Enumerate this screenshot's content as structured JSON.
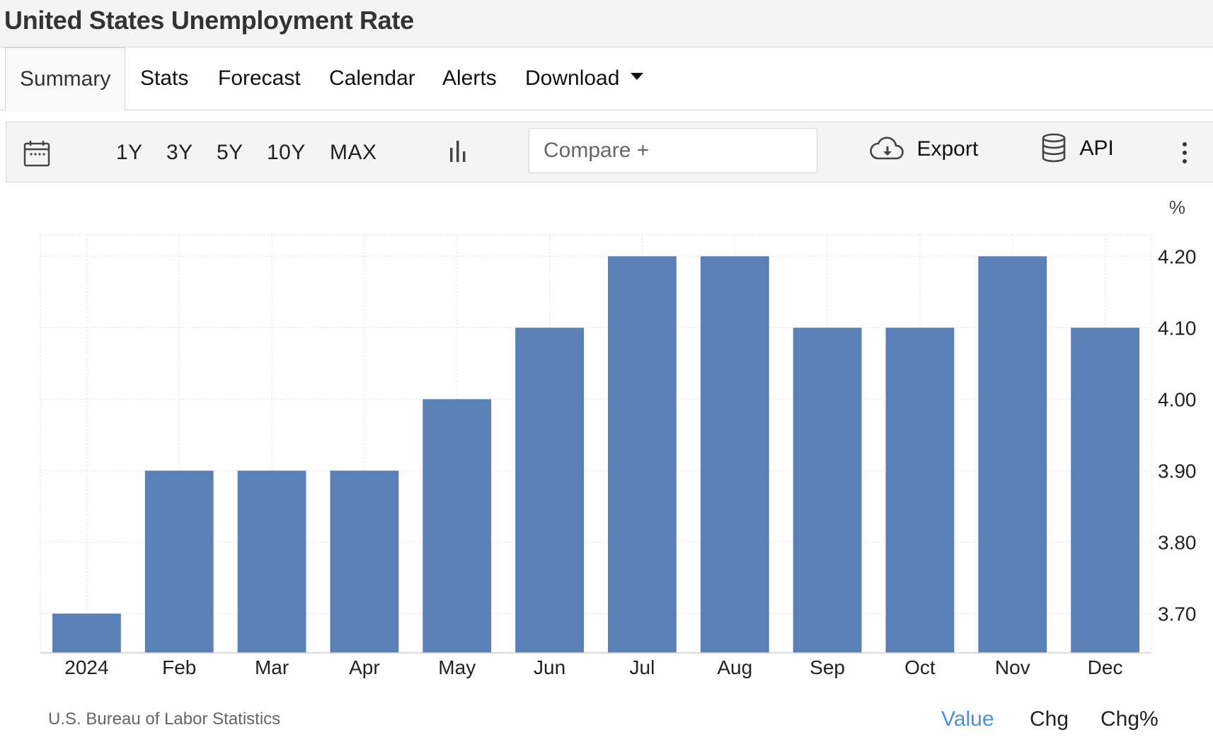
{
  "page": {
    "title": "United States Unemployment Rate"
  },
  "tabs": [
    {
      "label": "Summary",
      "active": true
    },
    {
      "label": "Stats"
    },
    {
      "label": "Forecast"
    },
    {
      "label": "Calendar"
    },
    {
      "label": "Alerts"
    },
    {
      "label": "Download",
      "dropdown": true
    }
  ],
  "toolbar": {
    "calendar_icon": "calendar-icon",
    "ranges": [
      "1Y",
      "3Y",
      "5Y",
      "10Y",
      "MAX"
    ],
    "chart_type_icon": "bar-chart-icon",
    "compare_placeholder": "Compare +",
    "export_label": "Export",
    "export_icon": "cloud-download-icon",
    "api_label": "API",
    "api_icon": "database-icon",
    "more_icon": "more-vertical-icon"
  },
  "chart_data": {
    "type": "bar",
    "categories": [
      "2024",
      "Feb",
      "Mar",
      "Apr",
      "May",
      "Jun",
      "Jul",
      "Aug",
      "Sep",
      "Oct",
      "Nov",
      "Dec"
    ],
    "values": [
      3.7,
      3.9,
      3.9,
      3.9,
      4.0,
      4.1,
      4.2,
      4.2,
      4.1,
      4.1,
      4.2,
      4.1
    ],
    "unit": "%",
    "yticks": [
      "3.70",
      "3.80",
      "3.90",
      "4.00",
      "4.10",
      "4.20"
    ],
    "ylim": [
      3.645,
      4.23
    ],
    "y_axis_position": "right",
    "grid": true,
    "bar_color": "#5a80b7"
  },
  "footer": {
    "source": "U.S. Bureau of Labor Statistics",
    "modes": [
      {
        "label": "Value",
        "active": true,
        "color": "#4a90e2"
      },
      {
        "label": "Chg"
      },
      {
        "label": "Chg%"
      }
    ]
  }
}
